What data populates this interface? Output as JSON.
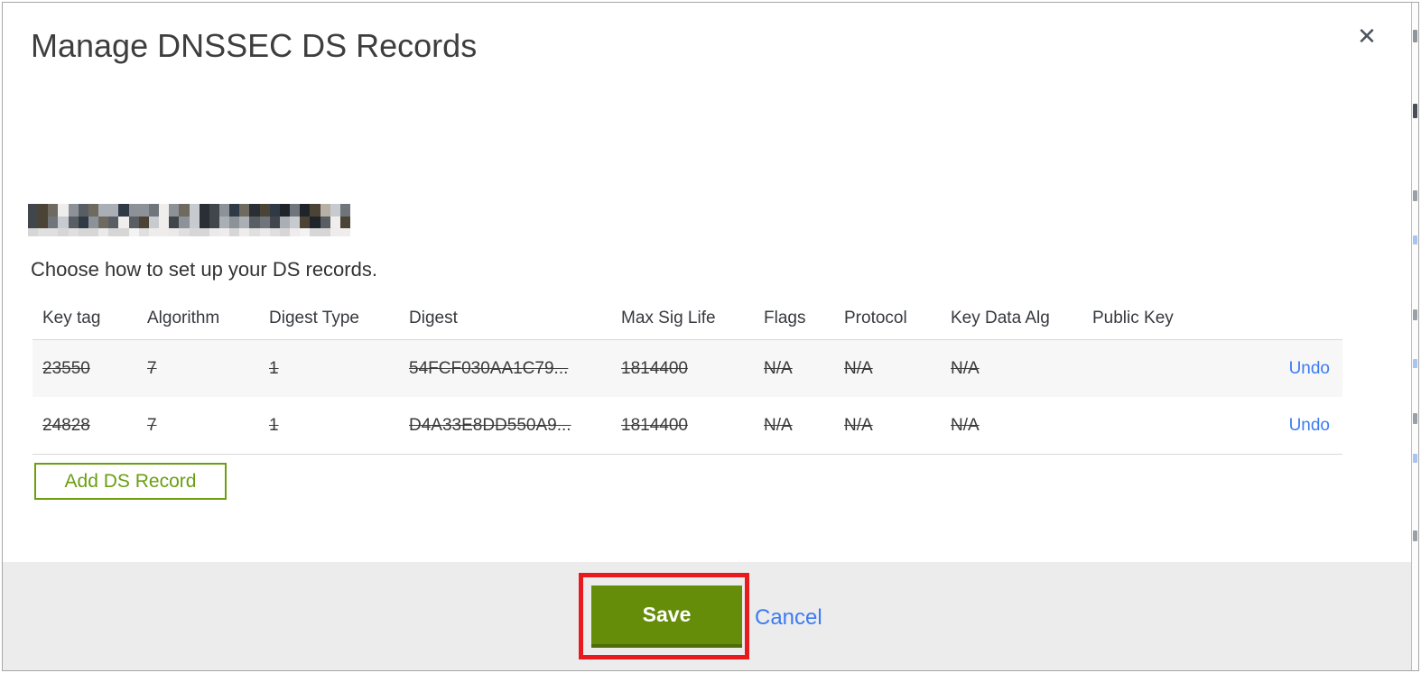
{
  "dialog": {
    "title": "Manage DNSSEC DS Records",
    "close_icon": "✕",
    "instruction": "Choose how to set up your DS records.",
    "table": {
      "headers": [
        "Key tag",
        "Algorithm",
        "Digest Type",
        "Digest",
        "Max Sig Life",
        "Flags",
        "Protocol",
        "Key Data Alg",
        "Public Key"
      ],
      "rows": [
        {
          "key_tag": "23550",
          "algorithm": "7",
          "digest_type": "1",
          "digest": "54FCF030AA1C79...",
          "max_sig_life": "1814400",
          "flags": "N/A",
          "protocol": "N/A",
          "key_data_alg": "N/A",
          "public_key": "",
          "action": "Undo"
        },
        {
          "key_tag": "24828",
          "algorithm": "7",
          "digest_type": "1",
          "digest": "D4A33E8DD550A9...",
          "max_sig_life": "1814400",
          "flags": "N/A",
          "protocol": "N/A",
          "key_data_alg": "N/A",
          "public_key": "",
          "action": "Undo"
        }
      ]
    },
    "add_ds_record_button": "Add DS Record",
    "footer": {
      "save_button": "Save",
      "cancel_link": "Cancel"
    },
    "colors": {
      "save_green": "#658d09",
      "outline_green": "#6b9e11",
      "link_blue": "#3c7bf3",
      "annotation_red": "#e81a1e",
      "row_stripe": "#f7f7f7",
      "footer_gray": "#ececec"
    }
  }
}
